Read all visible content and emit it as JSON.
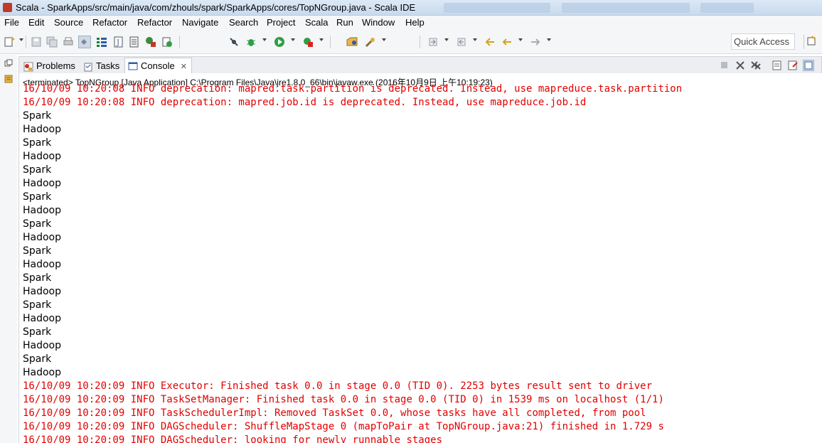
{
  "window": {
    "title": "Scala - SparkApps/src/main/java/com/zhouls/spark/SparkApps/cores/TopNGroup.java - Scala IDE"
  },
  "menu": [
    "File",
    "Edit",
    "Source",
    "Refactor",
    "Refactor",
    "Navigate",
    "Search",
    "Project",
    "Scala",
    "Run",
    "Window",
    "Help"
  ],
  "toolbar": {
    "quick_access": "Quick Access"
  },
  "tabs": {
    "problems": "Problems",
    "tasks": "Tasks",
    "console": "Console",
    "console_close": "✕"
  },
  "console": {
    "header": "<terminated> TopNGroup [Java Application] C:\\Program Files\\Java\\jre1.8.0_66\\bin\\javaw.exe (2016年10月9日 上午10:19:23)",
    "lines": [
      {
        "text": "16/10/09 10:20:08 INFO deprecation: mapred.task.partition is deprecated. Instead, use mapreduce.task.partition",
        "kind": "err"
      },
      {
        "text": "16/10/09 10:20:08 INFO deprecation: mapred.job.id is deprecated. Instead, use mapreduce.job.id",
        "kind": "err"
      },
      {
        "text": "Spark",
        "kind": "out"
      },
      {
        "text": "Hadoop",
        "kind": "out"
      },
      {
        "text": "Spark",
        "kind": "out"
      },
      {
        "text": "Hadoop",
        "kind": "out"
      },
      {
        "text": "Spark",
        "kind": "out"
      },
      {
        "text": "Hadoop",
        "kind": "out"
      },
      {
        "text": "Spark",
        "kind": "out"
      },
      {
        "text": "Hadoop",
        "kind": "out"
      },
      {
        "text": "Spark",
        "kind": "out"
      },
      {
        "text": "Hadoop",
        "kind": "out"
      },
      {
        "text": "Spark",
        "kind": "out"
      },
      {
        "text": "Hadoop",
        "kind": "out"
      },
      {
        "text": "Spark",
        "kind": "out"
      },
      {
        "text": "Hadoop",
        "kind": "out"
      },
      {
        "text": "Spark",
        "kind": "out"
      },
      {
        "text": "Hadoop",
        "kind": "out"
      },
      {
        "text": "Spark",
        "kind": "out"
      },
      {
        "text": "Hadoop",
        "kind": "out"
      },
      {
        "text": "Spark",
        "kind": "out"
      },
      {
        "text": "Hadoop",
        "kind": "out"
      },
      {
        "text": "16/10/09 10:20:09 INFO Executor: Finished task 0.0 in stage 0.0 (TID 0). 2253 bytes result sent to driver",
        "kind": "err"
      },
      {
        "text": "16/10/09 10:20:09 INFO TaskSetManager: Finished task 0.0 in stage 0.0 (TID 0) in 1539 ms on localhost (1/1)",
        "kind": "err"
      },
      {
        "text": "16/10/09 10:20:09 INFO TaskSchedulerImpl: Removed TaskSet 0.0, whose tasks have all completed, from pool",
        "kind": "err"
      },
      {
        "text": "16/10/09 10:20:09 INFO DAGScheduler: ShuffleMapStage 0 (mapToPair at TopNGroup.java:21) finished in 1.729 s",
        "kind": "err"
      },
      {
        "text": "16/10/09 10:20:09 INFO DAGScheduler: looking for newly runnable stages",
        "kind": "err"
      }
    ]
  },
  "colors": {
    "error_text": "#e10000",
    "stdout_text": "#000000"
  }
}
